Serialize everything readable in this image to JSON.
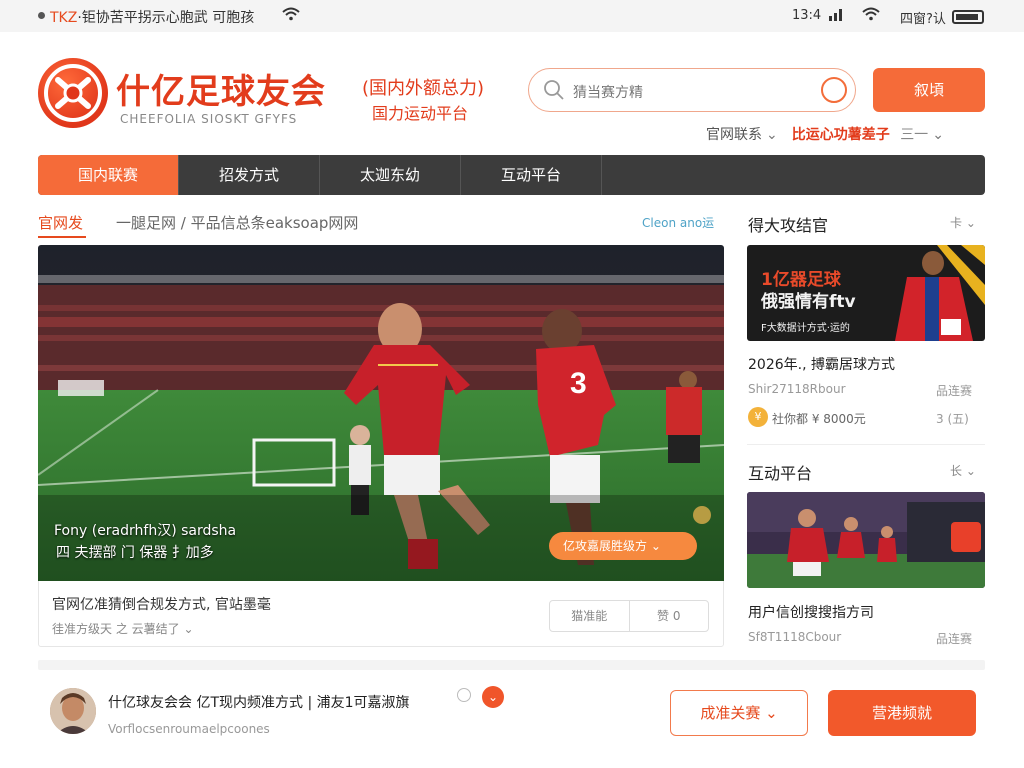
{
  "status_bar": {
    "left_prefix": "TKZ",
    "left_text": "·钜协苦平拐示心胞武  可胞孩",
    "time": "13:4",
    "right_text": "四窗?认"
  },
  "header": {
    "title": "什亿足球友会",
    "subtitle_en": "CHEEFOLIA SIOSKT GFYFS",
    "tagline1": "(国内外额总力)",
    "tagline2": "国力运动平台",
    "search_placeholder": "猜当赛方精",
    "login_label": "叙頃",
    "sub_links": {
      "link1": "官网联系",
      "hot": "比运心功薯差子",
      "link2": "三一"
    }
  },
  "nav": {
    "tabs": [
      "国内联赛",
      "招发方式",
      "太迦东幼",
      "互动平台"
    ]
  },
  "main": {
    "section_title": "官网发",
    "section_sub": "一腿足网 / 平品信总条eaksoap网网",
    "section_more": "Cleon ano运",
    "hero": {
      "caption1": "Fony (eradrhfh汉) sardsha",
      "caption2": "四 夫摆部 门 保器 扌加多",
      "pill_label": "亿攻嘉展胜级方",
      "description": "官网亿准猜倒合规发方式, 官站墨毫",
      "meta": "徍准方级天 之 云薯结了",
      "action1": "猫准能",
      "action2": "赞 0"
    }
  },
  "right": {
    "block1": {
      "heading": "得大攻结官",
      "more": "卡",
      "banner_text1": "1亿器足球",
      "banner_text2": "俄强情有ftv",
      "banner_small": "F大数据计方式·运的",
      "title": "2026年., 搏霸居球方式",
      "meta": "Shir27118Rbour",
      "meta_right": "品连赛",
      "coin_text": "社你都 ¥ 8000元",
      "coin_right": "3 (五)"
    },
    "block2": {
      "heading": "互动平台",
      "more": "长",
      "title": "用户信创搜搜指方司",
      "meta": "Sf8T1118Cbour",
      "meta_right": "品连赛"
    }
  },
  "bottom": {
    "title": "什亿球友会会  亿T现内频准方式 | 浦友1可嘉淑旗",
    "sub": "Vorflocsenroumaelpcoones",
    "btn_outline": "成准关赛",
    "btn_fill": "营港频就"
  },
  "colors": {
    "accent": "#f56b39",
    "brand_red": "#e23c1c",
    "nav_bg": "#3c3c3c"
  }
}
